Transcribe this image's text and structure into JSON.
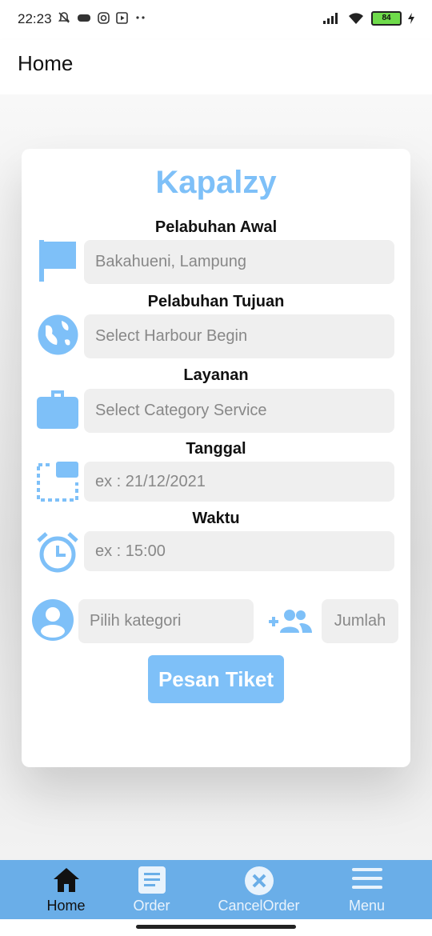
{
  "status_bar": {
    "time": "22:23",
    "battery": "84"
  },
  "app_bar": {
    "title": "Home"
  },
  "form": {
    "brand": "Kapalzy",
    "origin": {
      "label": "Pelabuhan Awal",
      "value": "Bakahueni, Lampung"
    },
    "destination": {
      "label": "Pelabuhan Tujuan",
      "placeholder": "Select Harbour Begin"
    },
    "service": {
      "label": "Layanan",
      "placeholder": "Select Category Service"
    },
    "date": {
      "label": "Tanggal",
      "placeholder": "ex : 21/12/2021"
    },
    "time": {
      "label": "Waktu",
      "placeholder": "ex : 15:00"
    },
    "category": {
      "placeholder": "Pilih kategori"
    },
    "quantity": {
      "placeholder": "Jumlah"
    },
    "submit_label": "Pesan Tiket"
  },
  "nav": {
    "items": [
      {
        "label": "Home",
        "icon": "home-icon",
        "active": true
      },
      {
        "label": "Order",
        "icon": "order-icon",
        "active": false
      },
      {
        "label": "CancelOrder",
        "icon": "cancel-icon",
        "active": false
      },
      {
        "label": "Menu",
        "icon": "menu-icon",
        "active": false
      }
    ]
  },
  "colors": {
    "accent": "#7ec0f8",
    "nav_bg": "#6aaee8",
    "input_bg": "#efefef"
  }
}
